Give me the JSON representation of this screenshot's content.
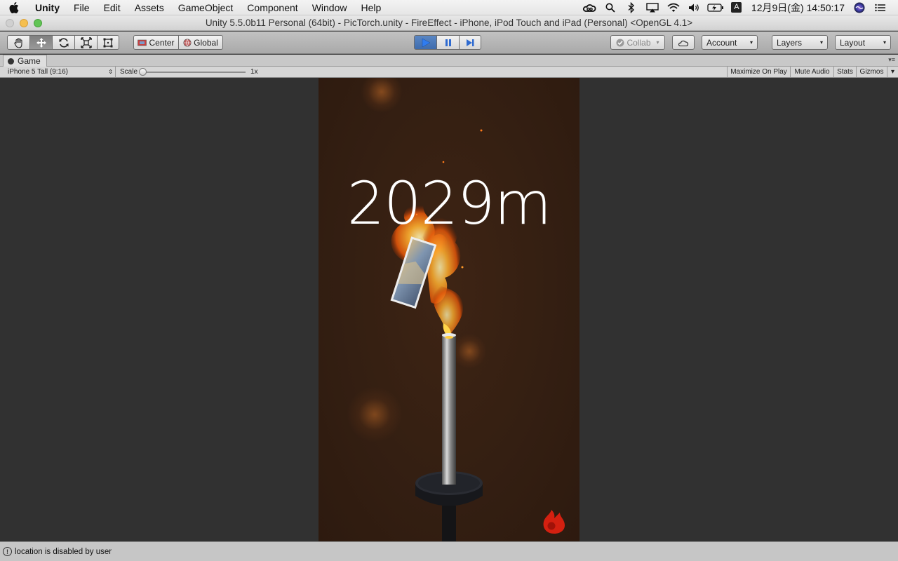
{
  "menubar": {
    "app_name": "Unity",
    "items": [
      "File",
      "Edit",
      "Assets",
      "GameObject",
      "Component",
      "Window",
      "Help"
    ],
    "clock": "12月9日(金)  14:50:17",
    "input_indicator": "A"
  },
  "window": {
    "title": "Unity 5.5.0b11 Personal (64bit) - PicTorch.unity - FireEffect - iPhone, iPod Touch and iPad (Personal) <OpenGL 4.1>"
  },
  "toolbar": {
    "pivot_mode": "Center",
    "pivot_rotation": "Global",
    "collab_label": "Collab",
    "account_label": "Account",
    "layers_label": "Layers",
    "layout_label": "Layout"
  },
  "game_panel": {
    "tab_label": "Game",
    "aspect": "iPhone 5 Tall (9:16)",
    "scale_label": "Scale",
    "scale_value": "1x",
    "scale_level": 0.0,
    "buttons": {
      "maximize": "Maximize On Play",
      "mute": "Mute Audio",
      "stats": "Stats",
      "gizmos": "Gizmos"
    }
  },
  "game": {
    "distance_text": "2029m"
  },
  "status": {
    "message": "location is disabled by user"
  },
  "colors": {
    "game_background": "#341f12",
    "fire": "#ff8a1c",
    "flame_badge": "#d42010",
    "play_accent": "#3f6cad"
  }
}
